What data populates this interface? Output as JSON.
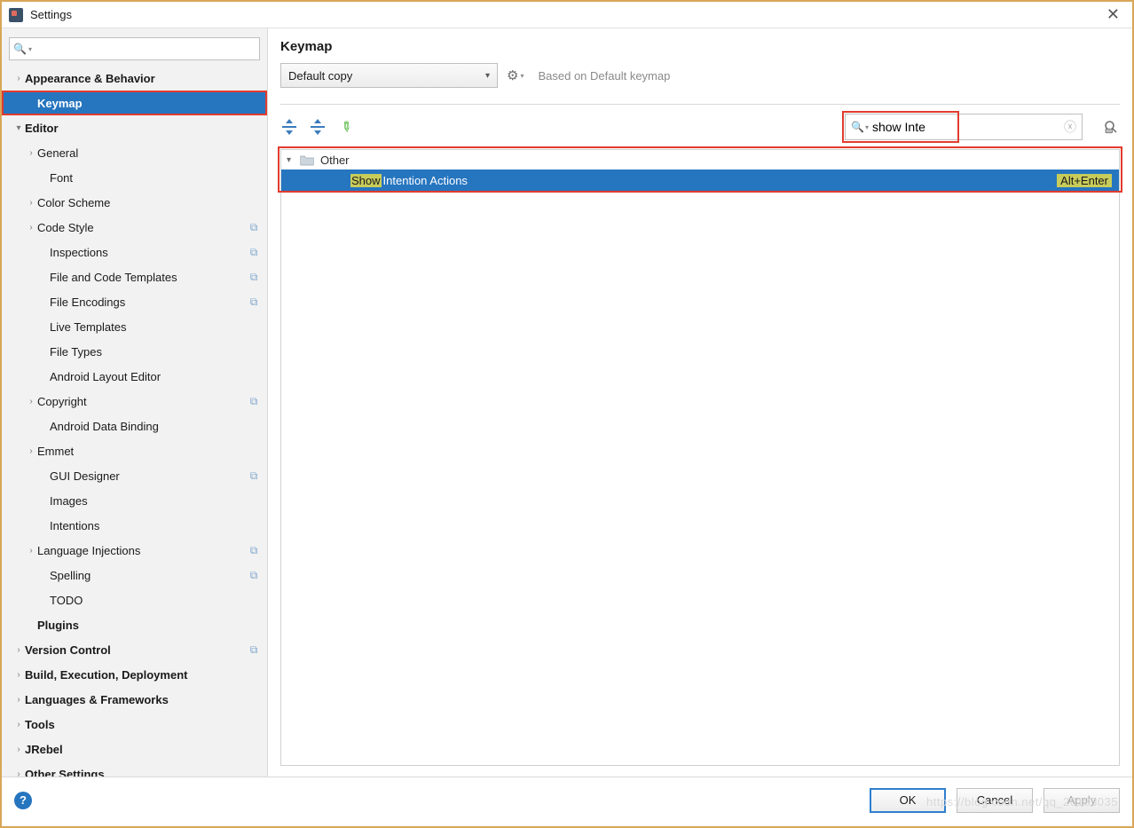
{
  "window": {
    "title": "Settings"
  },
  "sidebar": {
    "search_value": "",
    "items": [
      {
        "label": "Appearance & Behavior",
        "indent": 0,
        "arrow": "›",
        "bold": true,
        "copy": false,
        "selected": false,
        "hl": false
      },
      {
        "label": "Keymap",
        "indent": 1,
        "arrow": "",
        "bold": true,
        "copy": false,
        "selected": true,
        "hl": true
      },
      {
        "label": "Editor",
        "indent": 0,
        "arrow": "v",
        "bold": true,
        "copy": false,
        "selected": false,
        "hl": false
      },
      {
        "label": "General",
        "indent": 1,
        "arrow": "›",
        "bold": false,
        "copy": false,
        "selected": false,
        "hl": false
      },
      {
        "label": "Font",
        "indent": 2,
        "arrow": "",
        "bold": false,
        "copy": false,
        "selected": false,
        "hl": false
      },
      {
        "label": "Color Scheme",
        "indent": 1,
        "arrow": "›",
        "bold": false,
        "copy": false,
        "selected": false,
        "hl": false
      },
      {
        "label": "Code Style",
        "indent": 1,
        "arrow": "›",
        "bold": false,
        "copy": true,
        "selected": false,
        "hl": false
      },
      {
        "label": "Inspections",
        "indent": 2,
        "arrow": "",
        "bold": false,
        "copy": true,
        "selected": false,
        "hl": false
      },
      {
        "label": "File and Code Templates",
        "indent": 2,
        "arrow": "",
        "bold": false,
        "copy": true,
        "selected": false,
        "hl": false
      },
      {
        "label": "File Encodings",
        "indent": 2,
        "arrow": "",
        "bold": false,
        "copy": true,
        "selected": false,
        "hl": false
      },
      {
        "label": "Live Templates",
        "indent": 2,
        "arrow": "",
        "bold": false,
        "copy": false,
        "selected": false,
        "hl": false
      },
      {
        "label": "File Types",
        "indent": 2,
        "arrow": "",
        "bold": false,
        "copy": false,
        "selected": false,
        "hl": false
      },
      {
        "label": "Android Layout Editor",
        "indent": 2,
        "arrow": "",
        "bold": false,
        "copy": false,
        "selected": false,
        "hl": false
      },
      {
        "label": "Copyright",
        "indent": 1,
        "arrow": "›",
        "bold": false,
        "copy": true,
        "selected": false,
        "hl": false
      },
      {
        "label": "Android Data Binding",
        "indent": 2,
        "arrow": "",
        "bold": false,
        "copy": false,
        "selected": false,
        "hl": false
      },
      {
        "label": "Emmet",
        "indent": 1,
        "arrow": "›",
        "bold": false,
        "copy": false,
        "selected": false,
        "hl": false
      },
      {
        "label": "GUI Designer",
        "indent": 2,
        "arrow": "",
        "bold": false,
        "copy": true,
        "selected": false,
        "hl": false
      },
      {
        "label": "Images",
        "indent": 2,
        "arrow": "",
        "bold": false,
        "copy": false,
        "selected": false,
        "hl": false
      },
      {
        "label": "Intentions",
        "indent": 2,
        "arrow": "",
        "bold": false,
        "copy": false,
        "selected": false,
        "hl": false
      },
      {
        "label": "Language Injections",
        "indent": 1,
        "arrow": "›",
        "bold": false,
        "copy": true,
        "selected": false,
        "hl": false
      },
      {
        "label": "Spelling",
        "indent": 2,
        "arrow": "",
        "bold": false,
        "copy": true,
        "selected": false,
        "hl": false
      },
      {
        "label": "TODO",
        "indent": 2,
        "arrow": "",
        "bold": false,
        "copy": false,
        "selected": false,
        "hl": false
      },
      {
        "label": "Plugins",
        "indent": 1,
        "arrow": "",
        "bold": true,
        "copy": false,
        "selected": false,
        "hl": false
      },
      {
        "label": "Version Control",
        "indent": 0,
        "arrow": "›",
        "bold": true,
        "copy": true,
        "selected": false,
        "hl": false
      },
      {
        "label": "Build, Execution, Deployment",
        "indent": 0,
        "arrow": "›",
        "bold": true,
        "copy": false,
        "selected": false,
        "hl": false
      },
      {
        "label": "Languages & Frameworks",
        "indent": 0,
        "arrow": "›",
        "bold": true,
        "copy": false,
        "selected": false,
        "hl": false
      },
      {
        "label": "Tools",
        "indent": 0,
        "arrow": "›",
        "bold": true,
        "copy": false,
        "selected": false,
        "hl": false
      },
      {
        "label": "JRebel",
        "indent": 0,
        "arrow": "›",
        "bold": true,
        "copy": false,
        "selected": false,
        "hl": false
      },
      {
        "label": "Other Settings",
        "indent": 0,
        "arrow": "›",
        "bold": true,
        "copy": false,
        "selected": false,
        "hl": false
      }
    ]
  },
  "content": {
    "heading": "Keymap",
    "scheme_selected": "Default copy",
    "based_on": "Based on Default keymap",
    "search_value": "show Inte",
    "tree": {
      "group_label": "Other",
      "action_match": "Show",
      "action_rest": "Intention Actions",
      "action_shortcut": "Alt+Enter"
    }
  },
  "footer": {
    "ok": "OK",
    "cancel": "Cancel",
    "apply": "Apply",
    "help": "?"
  },
  "watermark": "https://blog.csdn.net/qq_20183035"
}
